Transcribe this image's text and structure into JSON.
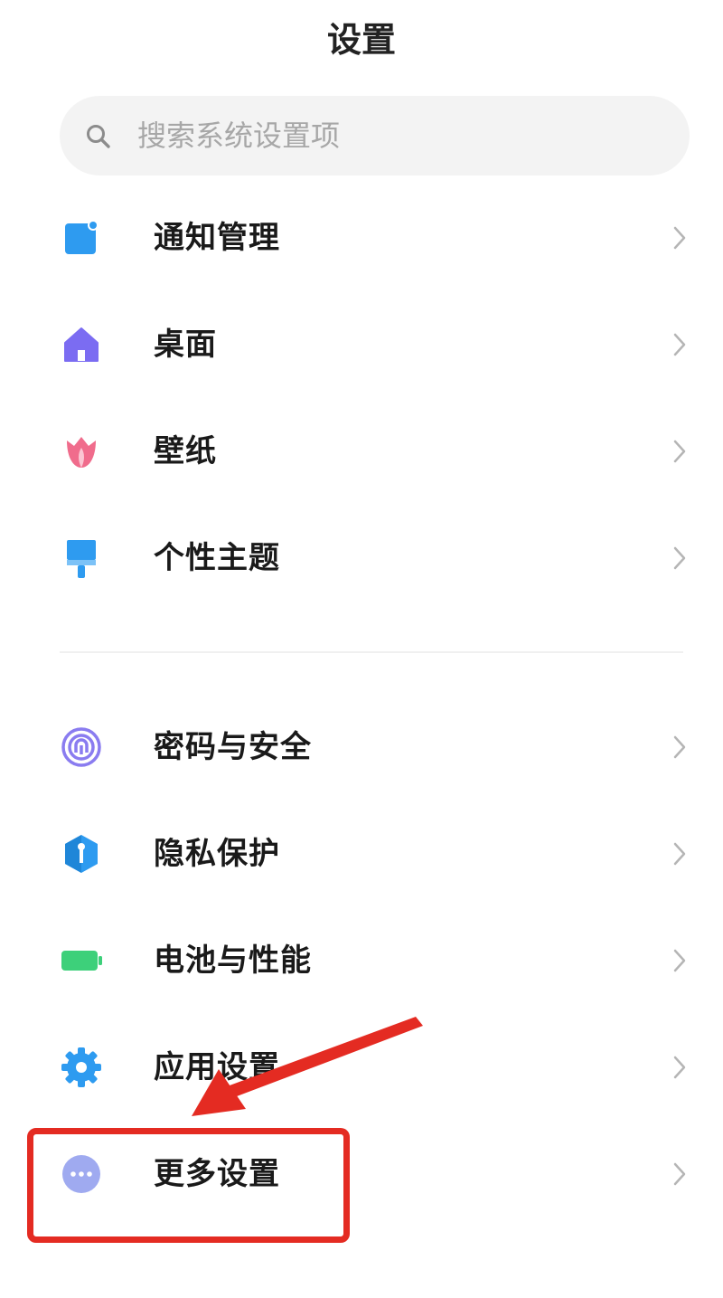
{
  "header": {
    "title": "设置"
  },
  "search": {
    "placeholder": "搜索系统设置项",
    "icon": "search-icon"
  },
  "sections": [
    {
      "items": [
        {
          "label": "通知管理",
          "icon": "notification-icon",
          "color": "#2e9bf0"
        },
        {
          "label": "桌面",
          "icon": "home-icon",
          "color": "#7b6cf2"
        },
        {
          "label": "壁纸",
          "icon": "tulip-icon",
          "color": "#f06c8c"
        },
        {
          "label": "个性主题",
          "icon": "brush-icon",
          "color": "#2e9bf0"
        }
      ]
    },
    {
      "items": [
        {
          "label": "密码与安全",
          "icon": "fingerprint-icon",
          "color": "#8a7cf0"
        },
        {
          "label": "隐私保护",
          "icon": "privacy-shield-icon",
          "color": "#2e9bf0"
        },
        {
          "label": "电池与性能",
          "icon": "battery-icon",
          "color": "#3dd07a"
        },
        {
          "label": "应用设置",
          "icon": "gear-icon",
          "color": "#2e9bf0"
        },
        {
          "label": "更多设置",
          "icon": "more-icon",
          "color": "#9faaf0"
        }
      ]
    }
  ],
  "annotation": {
    "highlight_color": "#e42b22",
    "highlighted_item": "更多设置"
  }
}
